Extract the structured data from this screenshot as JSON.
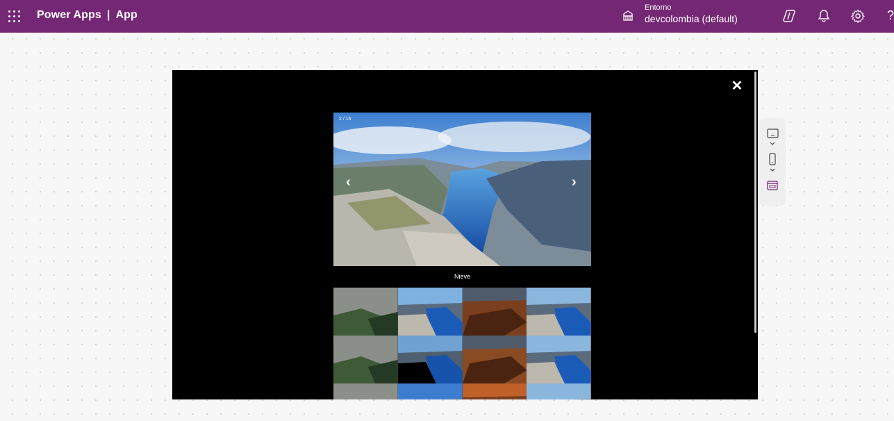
{
  "header": {
    "app_name": "Power Apps",
    "separator": "|",
    "page": "App",
    "environment_label": "Entorno",
    "environment_value": "devcolombia (default)",
    "help_glyph": "?",
    "icons": [
      "app-launcher-icon",
      "environment-icon",
      "copilot-icon",
      "notification-bell-icon",
      "settings-gear-icon",
      "help-icon"
    ]
  },
  "viewer": {
    "close_glyph": "✕",
    "counter": "2 / 16",
    "prev_glyph": "‹",
    "next_glyph": "›",
    "caption": "Nieve",
    "thumbnails": [
      "moss",
      "fjord",
      "rock",
      "fjord",
      "moss",
      "fjord",
      "rock",
      "fjord",
      "moss",
      "fjord",
      "rock",
      "fjord"
    ]
  },
  "side_toolbar": {
    "items": [
      "tablet-layout-icon",
      "chevron-down-icon",
      "phone-layout-icon",
      "chevron-down-icon",
      "app-preview-icon"
    ]
  },
  "colors": {
    "header_bg": "#742774",
    "stage_bg": "#000000",
    "accent": "#742774"
  }
}
